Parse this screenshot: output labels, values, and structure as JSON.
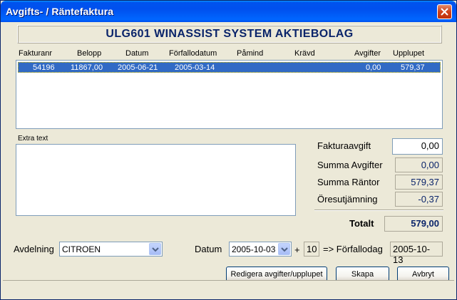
{
  "window": {
    "title": "Avgifts- / Räntefaktura"
  },
  "header": {
    "company": "ULG601  WINASSIST SYSTEM AKTIEBOLAG"
  },
  "table": {
    "columns": [
      "Fakturanr",
      "Belopp",
      "Datum",
      "Förfallodatum",
      "Påmind",
      "Krävd",
      "Avgifter",
      "Upplupet"
    ],
    "rows": [
      {
        "fakturanr": "54196",
        "belopp": "11867,00",
        "datum": "2005-06-21",
        "forfallodatum": "2005-03-14",
        "pamind": "",
        "kravd": "",
        "avgifter": "0,00",
        "upplupet": "579,37"
      }
    ]
  },
  "extra_text": {
    "label": "Extra text",
    "value": ""
  },
  "summary": {
    "fakturaavgift_label": "Fakturaavgift",
    "fakturaavgift_value": "0,00",
    "summa_avgifter_label": "Summa Avgifter",
    "summa_avgifter_value": "0,00",
    "summa_rantor_label": "Summa Räntor",
    "summa_rantor_value": "579,37",
    "oresutjamning_label": "Öresutjämning",
    "oresutjamning_value": "-0,37",
    "totalt_label": "Totalt",
    "totalt_value": "579,00"
  },
  "bottom": {
    "avdelning_label": "Avdelning",
    "avdelning_value": "CITROEN",
    "datum_label": "Datum",
    "datum_value": "2005-10-03",
    "plus_sign": "+",
    "days_value": "10",
    "arrow_label": "=> Förfallodag",
    "forfallodag_value": "2005-10-13"
  },
  "buttons": {
    "redigera": "Redigera avgifter/upplupet",
    "skapa": "Skapa",
    "avbryt": "Avbryt"
  },
  "colors": {
    "title_bar": "#0053ee",
    "selection": "#316ac5",
    "header_text": "#0a246a",
    "close_button": "#d0421a"
  },
  "icons": {
    "close": "close-icon",
    "dropdown": "chevron-down-icon"
  }
}
